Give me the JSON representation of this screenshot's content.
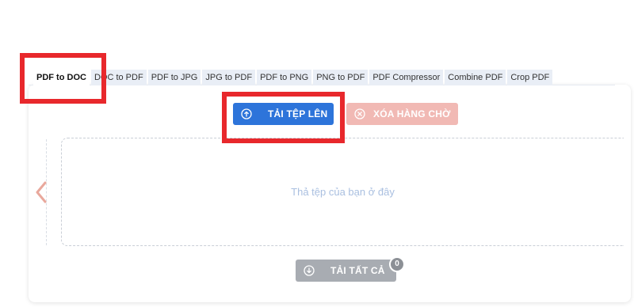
{
  "tabs": [
    {
      "label": "PDF to DOC",
      "active": true
    },
    {
      "label": "DOC to PDF",
      "active": false
    },
    {
      "label": "PDF to JPG",
      "active": false
    },
    {
      "label": "JPG to PDF",
      "active": false
    },
    {
      "label": "PDF to PNG",
      "active": false
    },
    {
      "label": "PNG to PDF",
      "active": false
    },
    {
      "label": "PDF Compressor",
      "active": false
    },
    {
      "label": "Combine PDF",
      "active": false
    },
    {
      "label": "Crop PDF",
      "active": false
    }
  ],
  "toolbar": {
    "upload_label": "TẢI TỆP LÊN",
    "clear_label": "XÓA HÀNG CHỜ"
  },
  "dropzone": {
    "placeholder": "Thả tệp của bạn ở đây"
  },
  "footer": {
    "download_all_label": "TẢI TẤT CẢ",
    "file_count": "0"
  },
  "icons": {
    "upload": "arrow-up-circle-icon",
    "clear": "x-circle-icon",
    "download": "arrow-down-circle-icon",
    "nav_prev": "chevron-left-icon"
  },
  "colors": {
    "primary": "#2d74da",
    "danger_disabled": "#f1b9b4",
    "neutral_disabled": "#a8acb2",
    "highlight": "#e8282c",
    "placeholder_text": "#a9bfe0"
  }
}
